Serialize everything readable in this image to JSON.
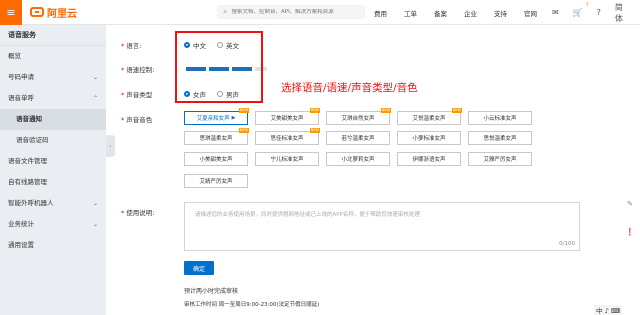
{
  "header": {
    "logo_text": "阿里云",
    "search_placeholder": "搜索文档、控制台、API、解决方案和资源",
    "nav": [
      "费用",
      "工单",
      "备案",
      "企业",
      "支持",
      "官网"
    ],
    "cart_badge": "7",
    "account_label": "简体"
  },
  "sidebar": {
    "title": "语音服务",
    "items": [
      {
        "label": "概览"
      },
      {
        "label": "号码申请"
      },
      {
        "label": "语音单呼"
      },
      {
        "label": "语音通知"
      },
      {
        "label": "语音验证码"
      },
      {
        "label": "语音文件管理"
      },
      {
        "label": "自有线路管理"
      },
      {
        "label": "智能外呼机器人"
      },
      {
        "label": "业务统计"
      },
      {
        "label": "通用设置"
      }
    ]
  },
  "form": {
    "language_label": "语言:",
    "language_options": [
      "中文",
      "英文"
    ],
    "speed_label": "语速控制:",
    "voice_type_label": "声音类型",
    "voice_type_options": [
      "女声",
      "男声"
    ],
    "timbre_label": "声音音色",
    "usage_label": "使用说明:",
    "usage_placeholder": "请描述您的业务使用场景，同时提供貌网地址或已上线的APP名称，便于帮助您快速审核处理",
    "usage_count": "0/100",
    "confirm_label": "确定",
    "note_review": "预计两小时完成审核",
    "note_hours": "审核工作时间 周一至周日9:00-23:00(法定节假日顺延)"
  },
  "annotation": "选择语音/语速/声音类型/音色",
  "voices": {
    "row1": [
      "艾夏亲和女声",
      "艾美甜美女声",
      "艾琪自然女声",
      "艾悦温柔女声",
      "小云标准女声"
    ],
    "row2": [
      "思琪温柔女声",
      "思佳标准女声",
      "若兮温柔女声",
      "小萝标准女声",
      "思悦温柔女声"
    ],
    "row3": [
      "小美甜美女声",
      "宁儿标准女声",
      "小北萝莉女声",
      "伊娜浙语女声",
      "艾雅严厉女声"
    ],
    "row4": [
      "艾婧严厉女声"
    ],
    "new_tag": "NEW"
  },
  "ime_text": "中 ♪ ⌨",
  "colors": {
    "brand": "#ff6a00",
    "primary": "#0070cc",
    "highlight": "#e11111"
  }
}
